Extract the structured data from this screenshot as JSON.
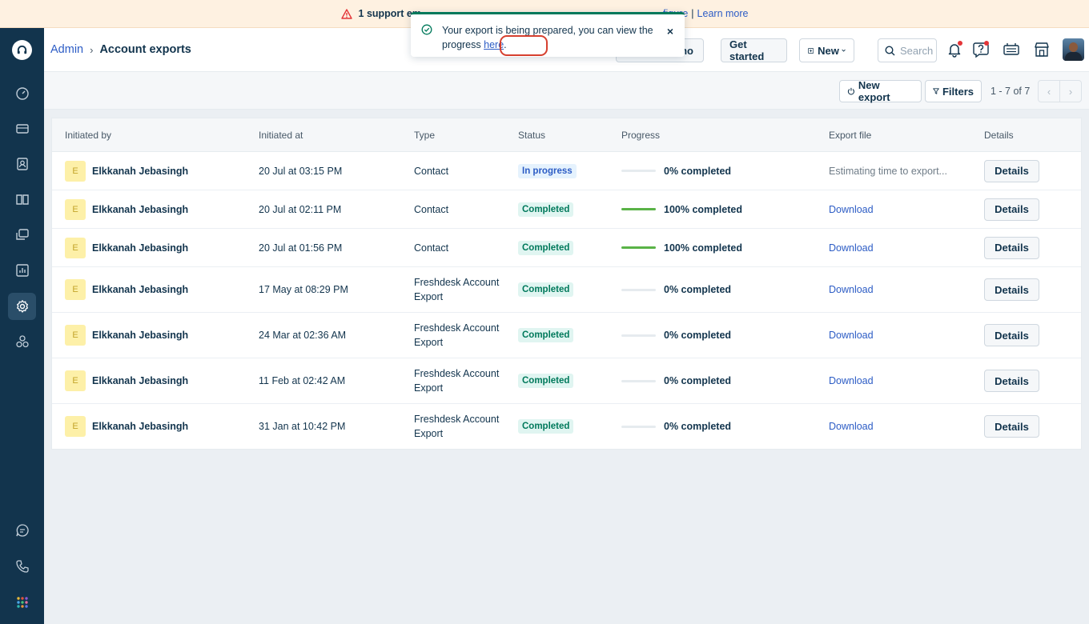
{
  "banner": {
    "bold_text": "1 support em",
    "link_configure": "figure",
    "separator": "|",
    "link_learn_more": "Learn more"
  },
  "toast": {
    "message_prefix": "Your export is being prepared, you can view the progress",
    "link_text": "here",
    "message_suffix": ".",
    "close": "×"
  },
  "header": {
    "breadcrumb_root": "Admin",
    "breadcrumb_sep": "›",
    "breadcrumb_current": "Account exports",
    "demo_btn": "no",
    "get_started": "Get started",
    "new_btn": "New",
    "search_placeholder": "Search"
  },
  "toolbar": {
    "new_export": "New export",
    "filters": "Filters",
    "pagination": "1 - 7 of 7",
    "prev": "‹",
    "next": "›"
  },
  "table": {
    "headers": {
      "initiated_by": "Initiated by",
      "initiated_at": "Initiated at",
      "type": "Type",
      "status": "Status",
      "progress": "Progress",
      "export_file": "Export file",
      "details": "Details"
    },
    "rows": [
      {
        "initial": "E",
        "name": "Elkkanah Jebasingh",
        "at": "20 Jul at 03:15 PM",
        "type": "Contact",
        "status": "In progress",
        "progress_pct": 0,
        "progress_text": "0% completed",
        "export_file": "Estimating time to export...",
        "details": "Details"
      },
      {
        "initial": "E",
        "name": "Elkkanah Jebasingh",
        "at": "20 Jul at 02:11 PM",
        "type": "Contact",
        "status": "Completed",
        "progress_pct": 100,
        "progress_text": "100% completed",
        "export_file": "Download",
        "details": "Details"
      },
      {
        "initial": "E",
        "name": "Elkkanah Jebasingh",
        "at": "20 Jul at 01:56 PM",
        "type": "Contact",
        "status": "Completed",
        "progress_pct": 100,
        "progress_text": "100% completed",
        "export_file": "Download",
        "details": "Details"
      },
      {
        "initial": "E",
        "name": "Elkkanah Jebasingh",
        "at": "17 May at 08:29 PM",
        "type": "Freshdesk Account Export",
        "status": "Completed",
        "progress_pct": 0,
        "progress_text": "0% completed",
        "export_file": "Download",
        "details": "Details"
      },
      {
        "initial": "E",
        "name": "Elkkanah Jebasingh",
        "at": "24 Mar at 02:36 AM",
        "type": "Freshdesk Account Export",
        "status": "Completed",
        "progress_pct": 0,
        "progress_text": "0% completed",
        "export_file": "Download",
        "details": "Details"
      },
      {
        "initial": "E",
        "name": "Elkkanah Jebasingh",
        "at": "11 Feb at 02:42 AM",
        "type": "Freshdesk Account Export",
        "status": "Completed",
        "progress_pct": 0,
        "progress_text": "0% completed",
        "export_file": "Download",
        "details": "Details"
      },
      {
        "initial": "E",
        "name": "Elkkanah Jebasingh",
        "at": "31 Jan at 10:42 PM",
        "type": "Freshdesk Account Export",
        "status": "Completed",
        "progress_pct": 0,
        "progress_text": "0% completed",
        "export_file": "Download",
        "details": "Details"
      }
    ]
  },
  "sidebar": {
    "items": [
      "dashboard-icon",
      "tickets-icon",
      "contacts-icon",
      "solutions-icon",
      "forums-icon",
      "reports-icon",
      "admin-settings-icon",
      "apps-icon",
      "chat-icon",
      "phone-icon",
      "app-switcher-icon"
    ],
    "active": "admin-settings-icon"
  },
  "colors": {
    "sidebar_bg": "#12344d",
    "accent_link": "#2c5cc5",
    "success": "#00795b",
    "progress_fill": "#5ab347",
    "banner_bg": "#fef1e1",
    "highlight": "#d6402f"
  }
}
